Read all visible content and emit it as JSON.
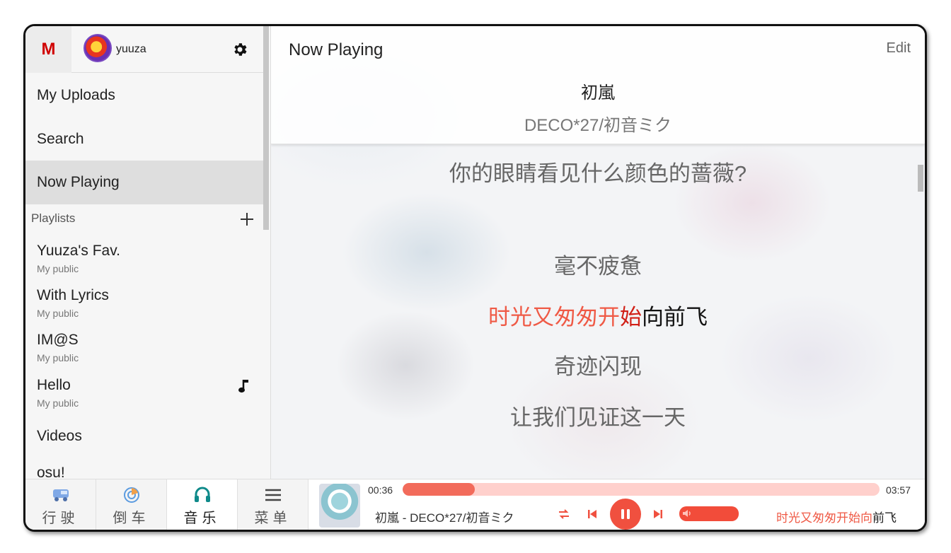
{
  "sidebar": {
    "logo": "M",
    "username": "yuuza",
    "nav": [
      {
        "label": "My Uploads"
      },
      {
        "label": "Search"
      },
      {
        "label": "Now Playing"
      }
    ],
    "playlists_label": "Playlists",
    "playlists": [
      {
        "title": "Yuuza's Fav.",
        "sub": "My public"
      },
      {
        "title": "With Lyrics",
        "sub": "My public"
      },
      {
        "title": "IM@S",
        "sub": "My public"
      },
      {
        "title": "Hello",
        "sub": "My public"
      }
    ],
    "extra": [
      {
        "title": "Videos"
      },
      {
        "title": "osu!"
      }
    ]
  },
  "main": {
    "title": "Now Playing",
    "edit": "Edit",
    "song_title": "初嵐",
    "song_artist": "DECO*27/初音ミク",
    "lyrics": {
      "line1": "你的眼睛看见什么颜色的蔷薇?",
      "line2": "毫不疲惫",
      "current_sung": "时光又匆匆开",
      "current_highlight": "始",
      "current_rest": "向前飞",
      "line4": "奇迹闪现",
      "line5": "让我们见证这一天"
    }
  },
  "tabs": [
    {
      "label": "行驶",
      "icon": "bus-icon"
    },
    {
      "label": "倒车",
      "icon": "radar-icon"
    },
    {
      "label": "音乐",
      "icon": "headphones-icon"
    },
    {
      "label": "菜单",
      "icon": "menu-icon"
    }
  ],
  "player": {
    "time_current": "00:36",
    "time_total": "03:57",
    "progress_fraction": 0.152,
    "now_playing_text": "初嵐 - DECO*27/初音ミク",
    "mini_lyric_sung": "时光又匆匆开始向",
    "mini_lyric_rest": "前飞",
    "accent": "#f0503f"
  }
}
